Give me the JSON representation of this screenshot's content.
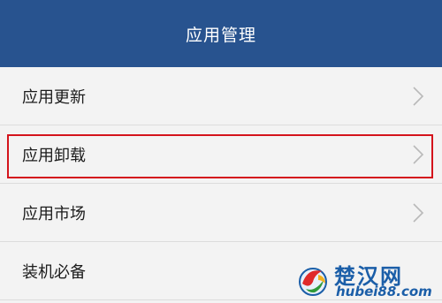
{
  "header": {
    "title": "应用管理"
  },
  "menu": {
    "items": [
      {
        "label": "应用更新",
        "has_chevron": true
      },
      {
        "label": "应用卸载",
        "has_chevron": true,
        "highlighted": true
      },
      {
        "label": "应用市场",
        "has_chevron": true
      },
      {
        "label": "装机必备",
        "has_chevron": false
      }
    ]
  },
  "watermark": {
    "brand": "楚汉网",
    "url": "hubei88.com"
  },
  "colors": {
    "header_bg": "#28538f",
    "highlight": "#d4141c",
    "background": "#f3f3f3",
    "watermark": "#1b5ea8"
  },
  "icons": {
    "chevron": "chevron-right-icon",
    "logo": "brand-logo-icon"
  }
}
